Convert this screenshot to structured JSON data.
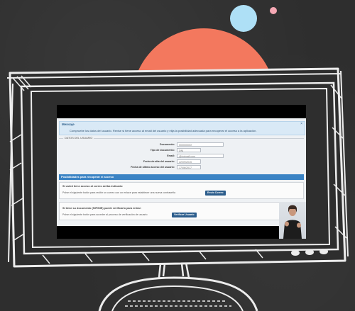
{
  "alert": {
    "title": "Mensaje",
    "message": "Compruebe los datos del usuario. Revise si tiene acceso al email del usuario y elija la posibilidad adecuada para recuperar el acceso a la aplicación.",
    "close": "×"
  },
  "user_data": {
    "legend": "DATOS DEL USUARIO",
    "fields": [
      {
        "label": "Documento:",
        "value": "00000000X"
      },
      {
        "label": "Tipo de documento:",
        "value": "DNI"
      },
      {
        "label": "Email:",
        "value": "@hotmail.com"
      },
      {
        "label": "Fecha de alta del usuario:",
        "value": "22/09/2015"
      },
      {
        "label": "Fecha de último acceso del usuario:",
        "value": "17/06/2017"
      }
    ]
  },
  "recovery": {
    "header": "Posibilidades para recuperar el acceso",
    "email_box": {
      "heading": "Si usted tiene acceso al correo arriba indicado:",
      "text": "Pulse el siguiente botón para recibir un correo con un enlace para establecer una nueva contraseña",
      "button": "Envío Correo"
    },
    "dni_box": {
      "heading": "Si tiene su documento (NIF/NIE) puede verificarlo para entrar:",
      "text": "Pulse el siguiente botón para acceder al proceso de verificación de usuario",
      "button": "Verificar Usuario"
    }
  },
  "colors": {
    "background": "#2e2e2e",
    "blue_circle": "#aee0f6",
    "pink_circle": "#f6a8b4",
    "orange_circle": "#f3785e",
    "panel_header": "#3a83c4",
    "button": "#2c5d8c"
  }
}
